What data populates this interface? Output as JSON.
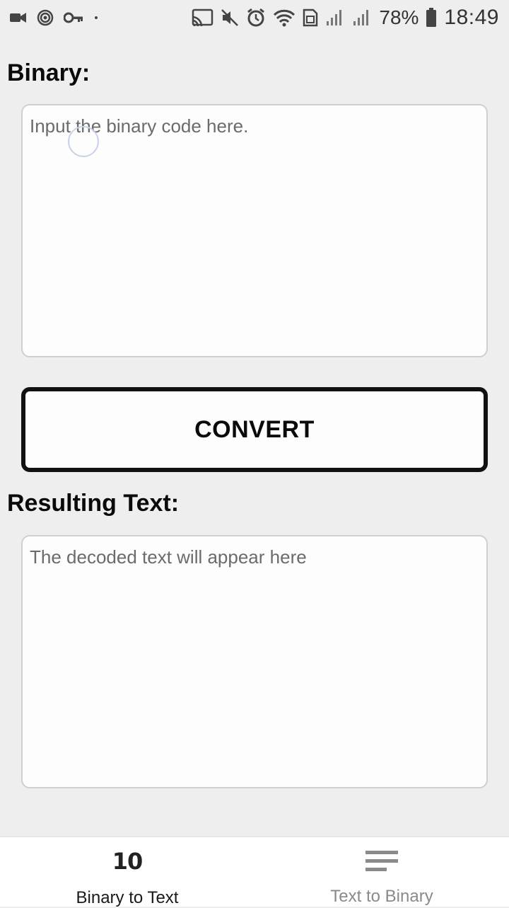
{
  "status_bar": {
    "left_icons": [
      "video-camera-icon",
      "target-icon",
      "key-icon",
      "dot-icon"
    ],
    "right_icons": [
      "cast-icon",
      "mute-icon",
      "alarm-icon",
      "wifi-icon",
      "sim-icon",
      "signal-icon",
      "signal-icon"
    ],
    "battery": "78%",
    "time": "18:49"
  },
  "binary_section": {
    "title": "Binary:",
    "placeholder": "Input the binary code here."
  },
  "convert_button": {
    "label": "CONVERT"
  },
  "result_section": {
    "title": "Resulting Text:",
    "placeholder": "The decoded text will appear here"
  },
  "bottom_nav": {
    "items": [
      {
        "icon_text": "10",
        "label": "Binary to Text",
        "active": true
      },
      {
        "icon": "lines-icon",
        "label": "Text to Binary",
        "active": false
      }
    ]
  }
}
